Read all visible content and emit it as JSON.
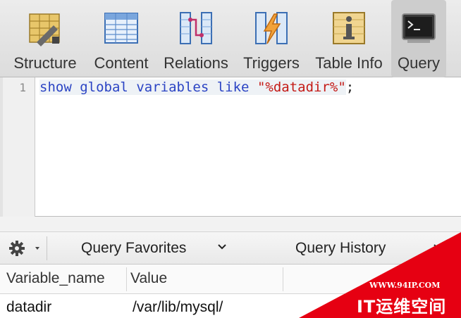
{
  "toolbar": {
    "tabs": [
      {
        "label": "Structure",
        "icon": "structure-icon"
      },
      {
        "label": "Content",
        "icon": "content-icon"
      },
      {
        "label": "Relations",
        "icon": "relations-icon"
      },
      {
        "label": "Triggers",
        "icon": "triggers-icon"
      },
      {
        "label": "Table Info",
        "icon": "table-info-icon"
      },
      {
        "label": "Query",
        "icon": "query-icon",
        "active": true
      }
    ]
  },
  "editor": {
    "line_number": "1",
    "tokens": {
      "t1": "show",
      "t2": "global",
      "t3": "variables",
      "t4": "like",
      "t5": "\"%datadir%\"",
      "t6": ";"
    }
  },
  "query_bar": {
    "gear_icon": "gear-icon",
    "favorites_label": "Query Favorites",
    "history_label": "Query History"
  },
  "results": {
    "columns": [
      "Variable_name",
      "Value"
    ],
    "rows": [
      [
        "datadir",
        "/var/lib/mysql/"
      ]
    ]
  },
  "watermark": {
    "url": "WWW.94IP.COM",
    "text": "IT运维空间"
  },
  "colors": {
    "keyword": "#2b44c4",
    "string": "#c41a16",
    "watermark_red": "#e60012"
  }
}
